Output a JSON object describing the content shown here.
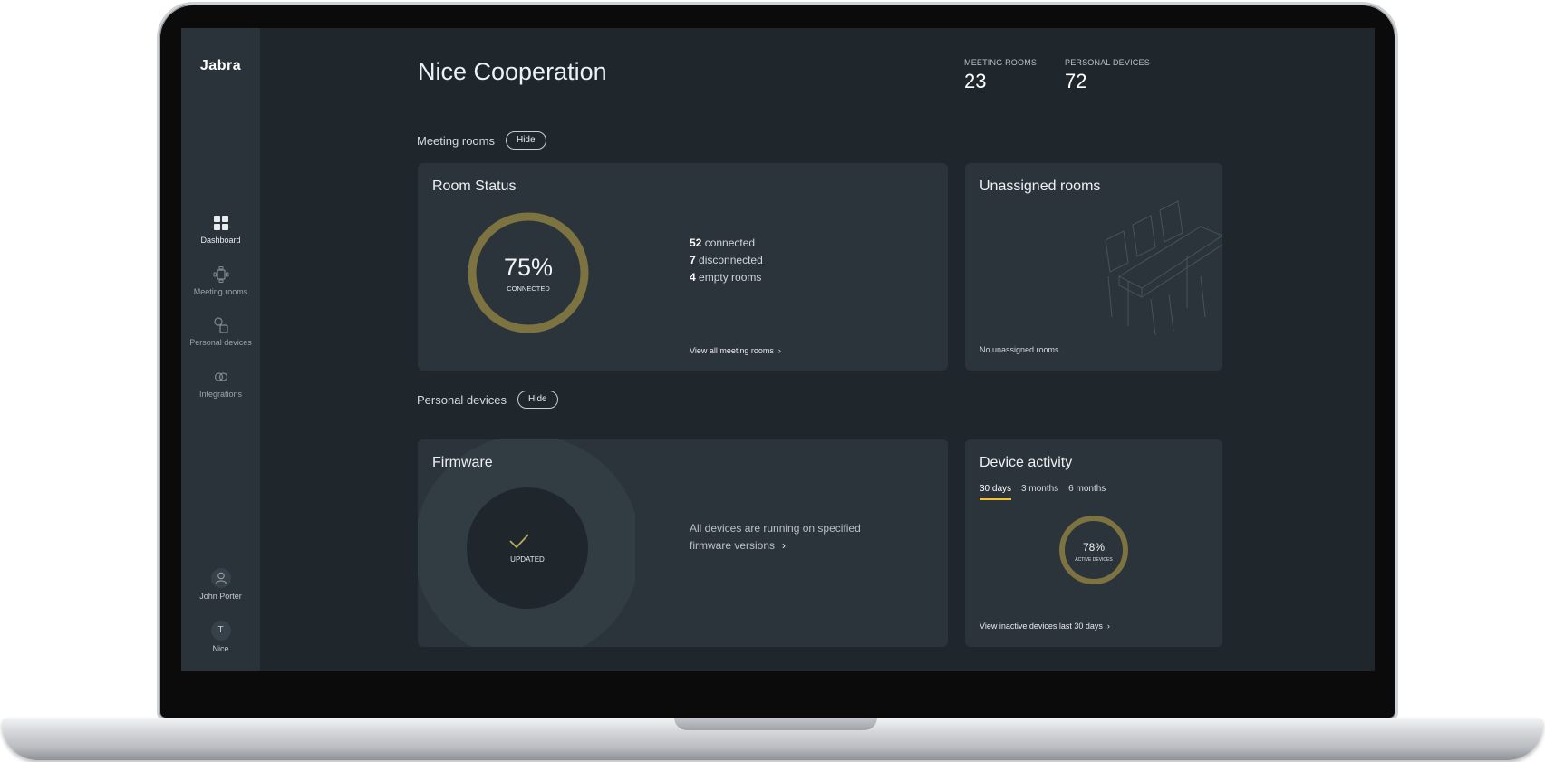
{
  "brand": "Jabra",
  "sidebar": {
    "items": [
      {
        "label": "Dashboard",
        "icon": "dashboard-icon"
      },
      {
        "label": "Meeting rooms",
        "icon": "meeting-room-icon"
      },
      {
        "label": "Personal devices",
        "icon": "devices-icon"
      },
      {
        "label": "Integrations",
        "icon": "integrations-icon"
      }
    ],
    "user": {
      "name": "John Porter",
      "icon": "user-icon"
    },
    "org": {
      "initial": "T",
      "name": "Nice"
    }
  },
  "header": {
    "title": "Nice Cooperation",
    "stats": [
      {
        "label": "MEETING ROOMS",
        "value": "23"
      },
      {
        "label": "PERSONAL DEVICES",
        "value": "72"
      }
    ]
  },
  "meeting_rooms": {
    "section_title": "Meeting rooms",
    "hide_label": "Hide",
    "room_status": {
      "title": "Room Status",
      "percent_text": "75%",
      "percent_value": 75,
      "sub_label": "CONNECTED",
      "connected_count": "52",
      "connected_text": "connected",
      "disconnected_count": "7",
      "disconnected_text": "disconnected",
      "empty_count": "4",
      "empty_text": "empty rooms",
      "link": "View all meeting rooms"
    },
    "unassigned": {
      "title": "Unassigned rooms",
      "note": "No unassigned rooms"
    }
  },
  "personal_devices": {
    "section_title": "Personal devices",
    "hide_label": "Hide",
    "firmware": {
      "title": "Firmware",
      "status_label": "UPDATED",
      "message": "All devices are running on specified firmware versions"
    },
    "device_activity": {
      "title": "Device activity",
      "tabs": [
        "30 days",
        "3 months",
        "6 months"
      ],
      "active_tab": "30 days",
      "percent_text": "78%",
      "percent_value": 78,
      "sub_label": "ACTIVE DEVICES",
      "link": "View inactive devices last 30 days"
    }
  },
  "colors": {
    "accent_ring": "#7c7340",
    "tab_underline": "#f2c230",
    "screen_bg": "#1f272d",
    "card_bg": "#2b343b",
    "sidebar_bg": "#2a333a"
  }
}
